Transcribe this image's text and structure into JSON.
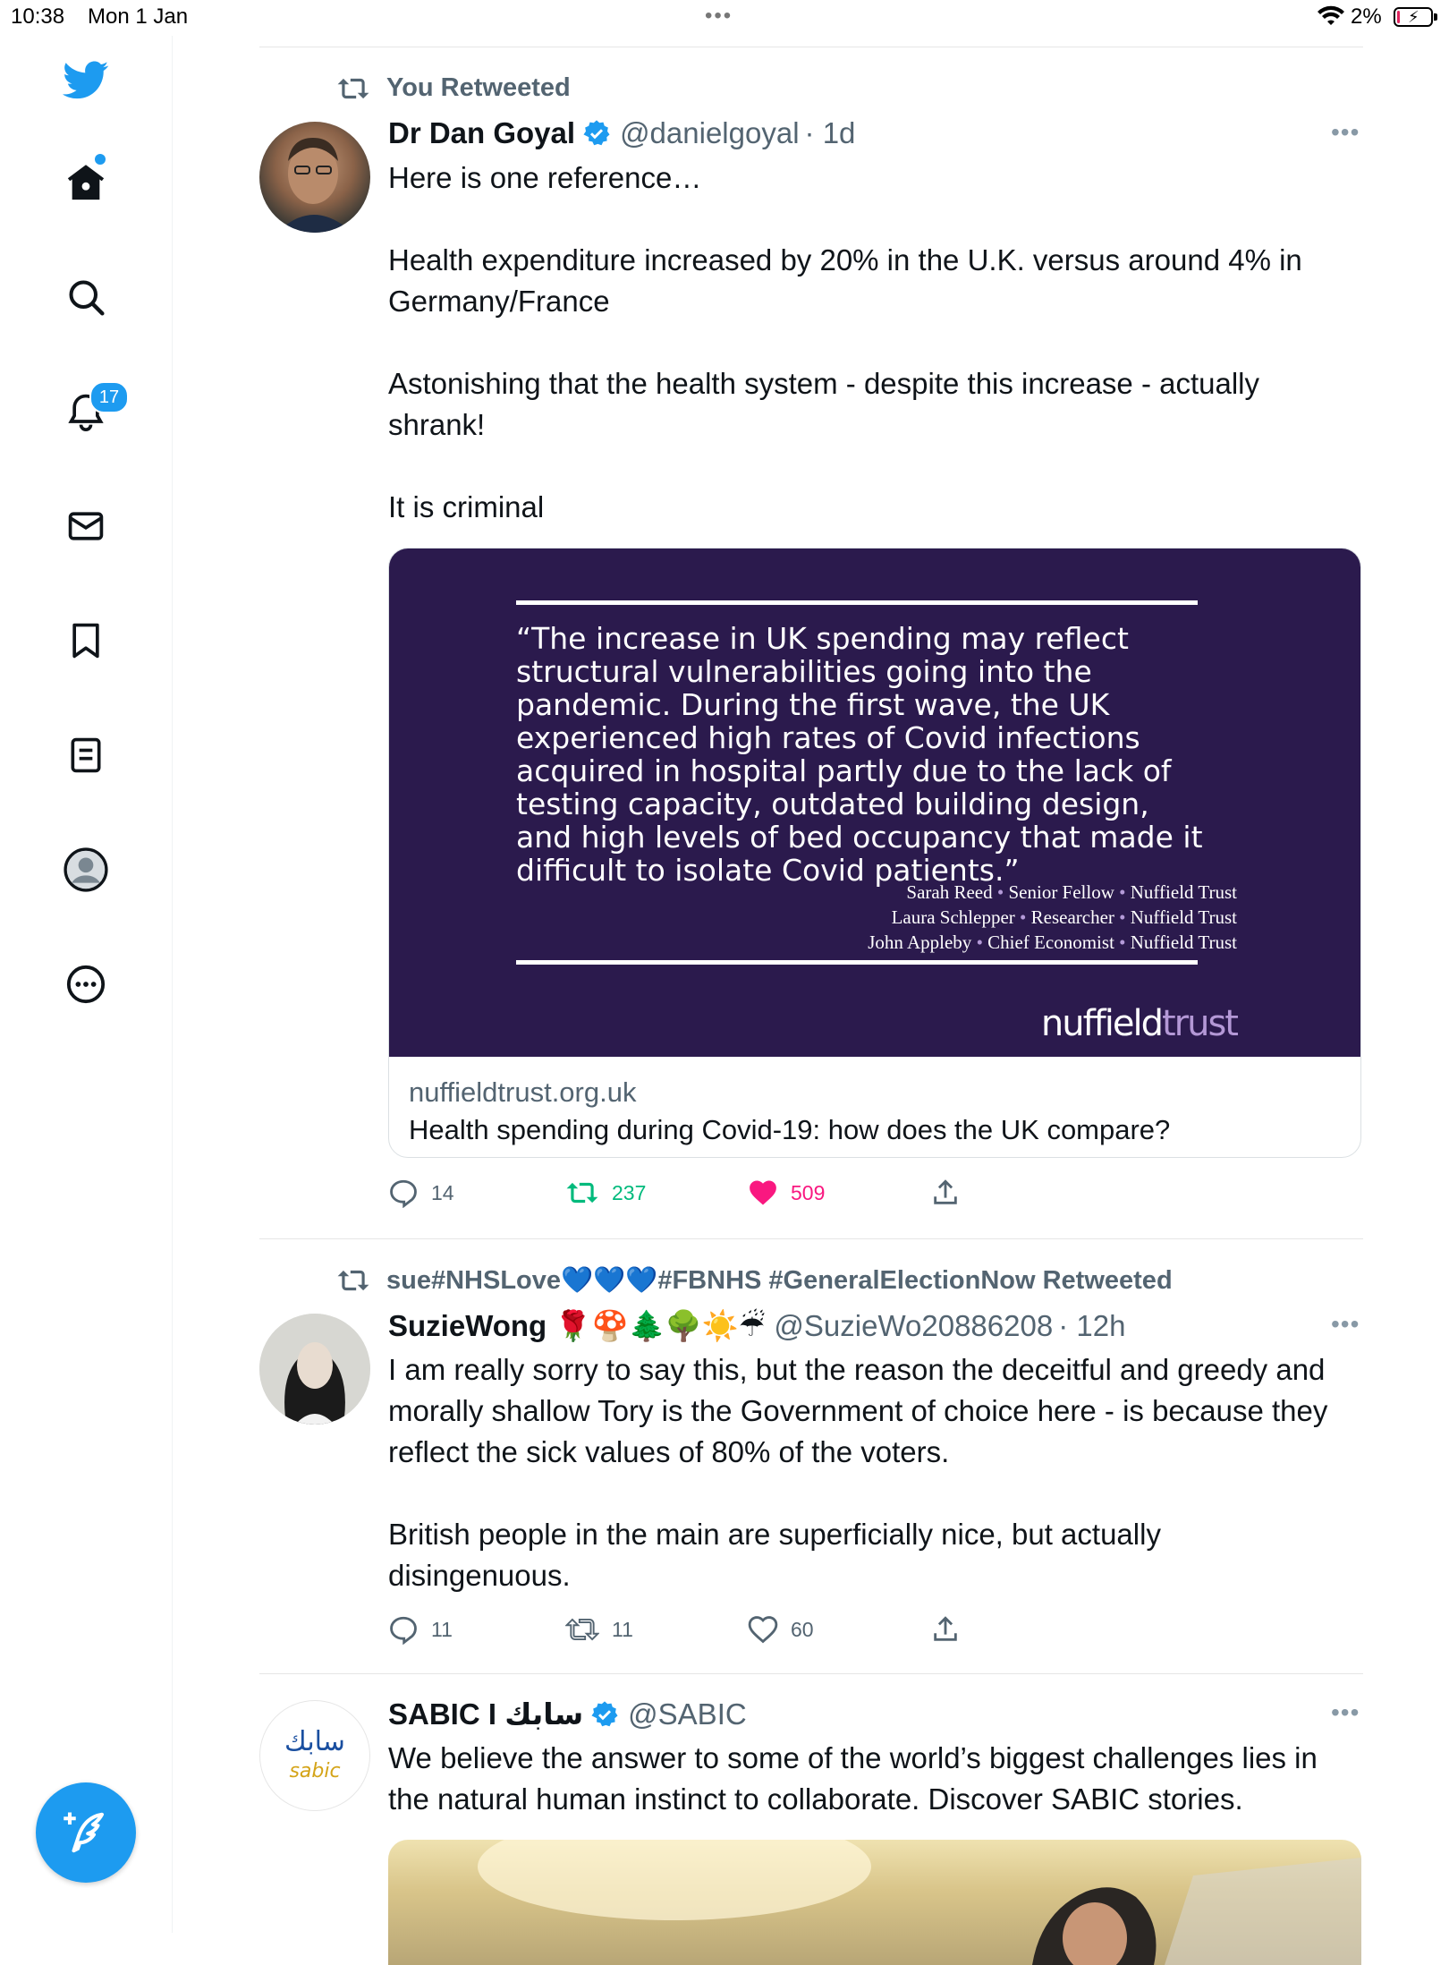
{
  "status_bar": {
    "time": "10:38",
    "date": "Mon 1 Jan",
    "battery": "2%"
  },
  "sidebar": {
    "items": [
      {
        "name": "home"
      },
      {
        "name": "explore"
      },
      {
        "name": "notifications"
      },
      {
        "name": "messages"
      },
      {
        "name": "bookmarks"
      },
      {
        "name": "lists"
      },
      {
        "name": "profile"
      },
      {
        "name": "more"
      }
    ],
    "notifications_badge": "17"
  },
  "tweets": [
    {
      "retweet_label": "You Retweeted",
      "name": "Dr Dan Goyal",
      "handle": "@danielgoyal",
      "time": "· 1d",
      "text": "Here is one reference…\n\nHealth expenditure increased by 20% in the U.K. versus around 4% in\nGermany/France\n\nAstonishing that the health system - despite this increase - actually\nshrank!\n\nIt is criminal",
      "card": {
        "quote": "“The increase in UK spending may reflect structural vulnerabilities going into the pandemic. During the first wave, the UK experienced high rates of Covid infections acquired in hospital partly due to the lack of testing capacity, outdated building design, and high levels of bed occupancy that made it difficult to isolate Covid patients.”",
        "credits": [
          [
            "Sarah Reed",
            "Senior Fellow",
            "Nuffield Trust"
          ],
          [
            "Laura Schlepper",
            "Researcher",
            "Nuffield Trust"
          ],
          [
            "John Appleby",
            "Chief Economist",
            "Nuffield Trust"
          ]
        ],
        "logo_a": "nuffield",
        "logo_b": "trust",
        "domain": "nuffieldtrust.org.uk",
        "title": "Health spending during Covid-19: how does the UK compare?"
      },
      "replies": "14",
      "retweets": "237",
      "likes": "509"
    },
    {
      "retweet_label": "sue#NHSLove💙💙💙#FBNHS #GeneralElectionNow Retweeted",
      "name": "SuzieWong 🌹🍄🌲🌳☀️☔",
      "handle": "@SuzieWo20886208",
      "time": "· 12h",
      "text": "I am really sorry to say this, but the reason the deceitful and greedy and\nmorally shallow Tory is the Government of choice here - is because they\nreflect the sick values of 80% of the voters.\n\nBritish people in the main are superficially nice, but actually\ndisingenuous.",
      "replies": "11",
      "retweets": "11",
      "likes": "60"
    },
    {
      "name": "SABIC I سابك",
      "handle": "@SABIC",
      "avatar_text_a": "سابك",
      "avatar_text_b": "sabic",
      "text": "We believe the answer to some of the world’s biggest challenges lies in\nthe natural human instinct to collaborate. Discover SABIC stories."
    }
  ],
  "colors": {
    "accent": "#1d9bf0",
    "retweet_green": "#00ba7c",
    "like_pink": "#f91880",
    "card_bg": "#2b1a4d"
  }
}
